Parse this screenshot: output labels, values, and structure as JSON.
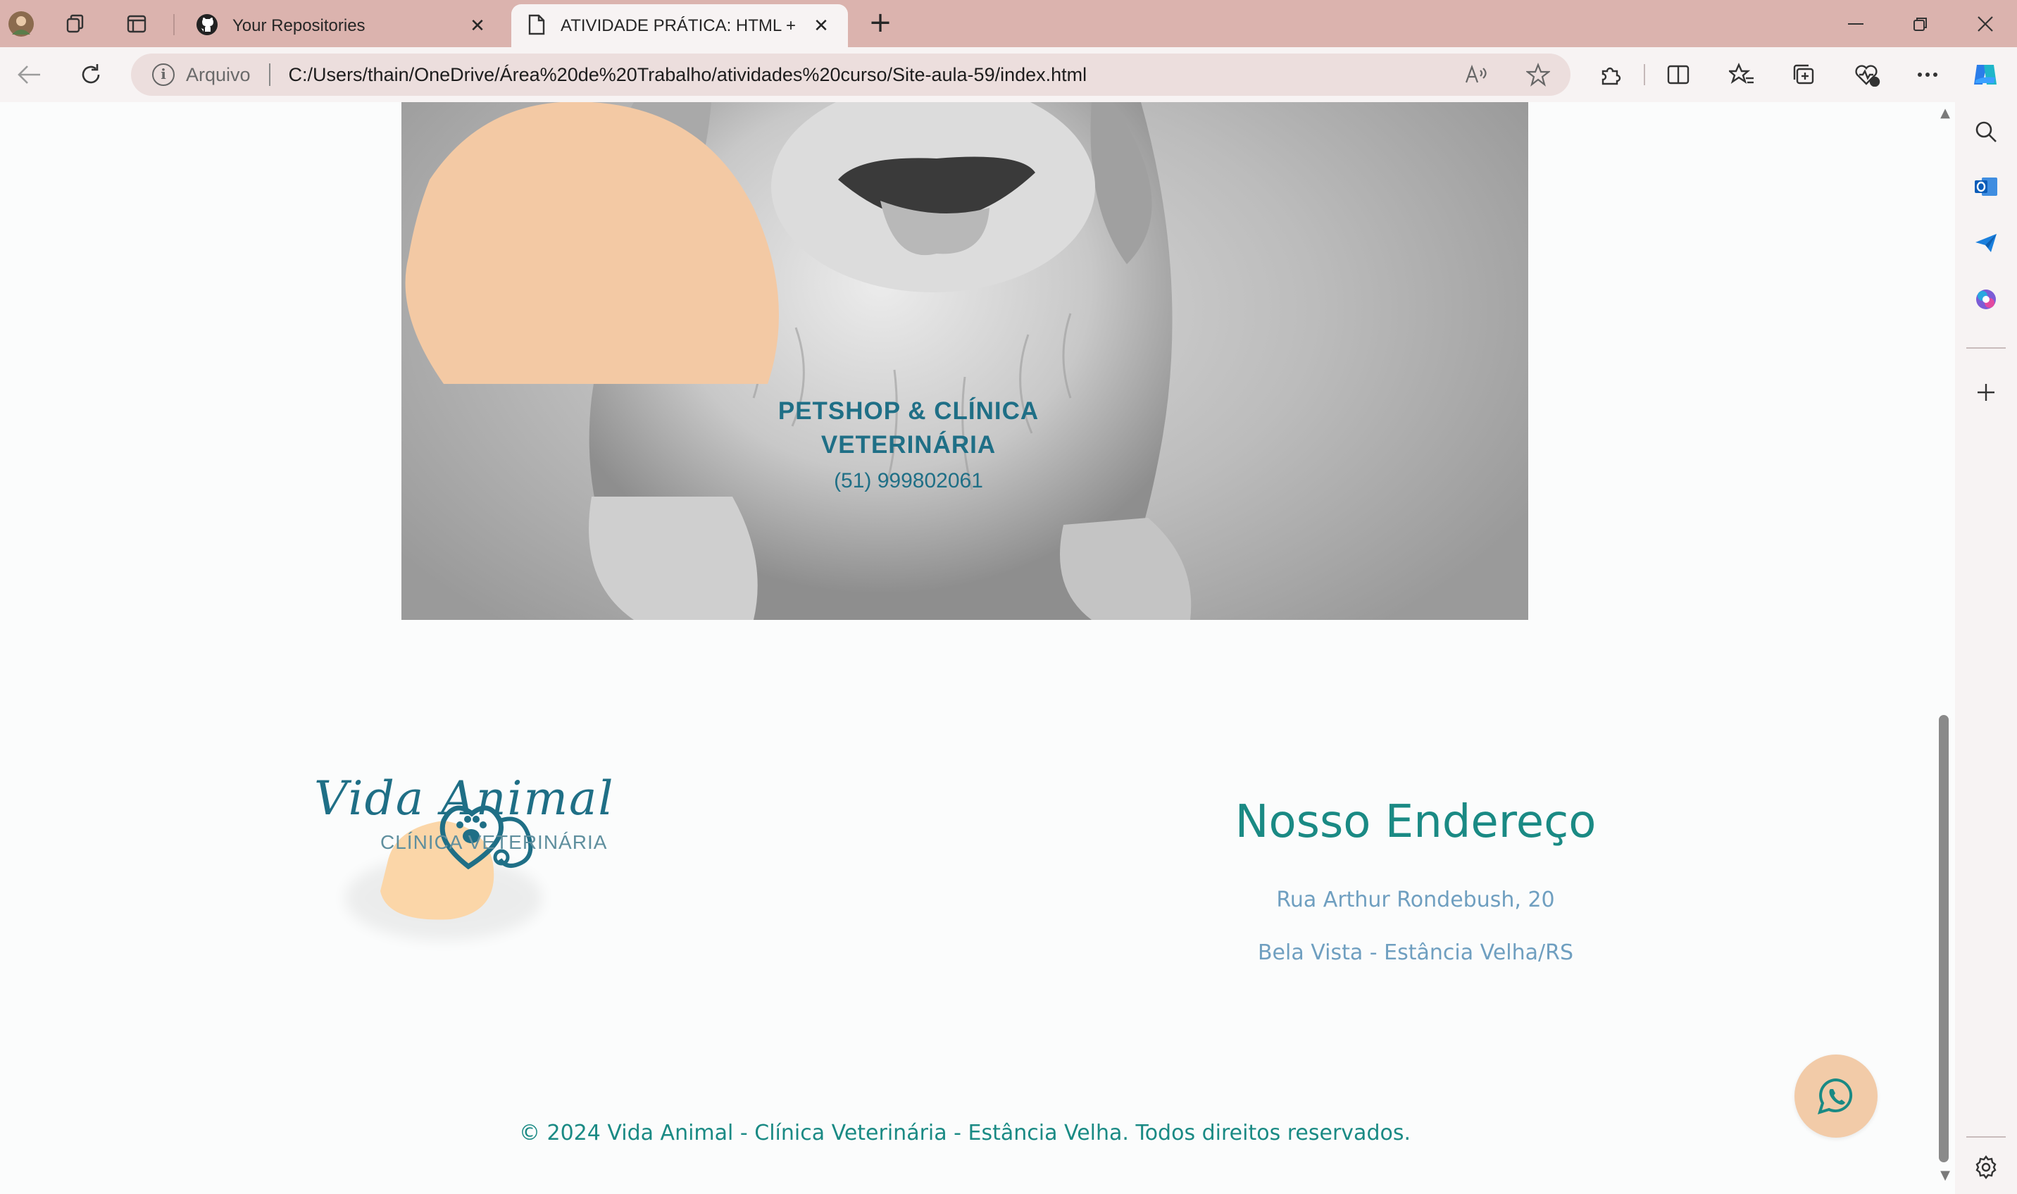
{
  "tabs": [
    {
      "title": "Your Repositories",
      "close": "✕"
    },
    {
      "title": "ATIVIDADE PRÁTICA: HTML + CSS",
      "close": "✕"
    }
  ],
  "new_tab": "+",
  "window_controls": {
    "minimize": "—",
    "restore": "❐",
    "close": "✕"
  },
  "address_bar": {
    "scheme_label": "Arquivo",
    "info_glyph": "i",
    "url": "C:/Users/thain/OneDrive/Área%20de%20Trabalho/atividades%20curso/Site-aula-59/index.html"
  },
  "hero": {
    "badge_line1": "PETSHOP & CLÍNICA",
    "badge_line2": "VETERINÁRIA",
    "badge_phone": "(51) 999802061"
  },
  "logo": {
    "script_name": "Vida Animal",
    "subtitle": "CLÍNICA VETERINÁRIA"
  },
  "address_section": {
    "title": "Nosso Endereço",
    "street": "Rua Arthur Rondebush, 20",
    "city": "Bela Vista - Estância Velha/RS"
  },
  "footer": {
    "copyright": "© 2024 Vida Animal - Clínica Veterinária - Estância Velha. Todos direitos reservados."
  },
  "colors": {
    "teal": "#1a8a84",
    "badge_peach": "#f3c9a4",
    "tab_strip": "#dbb3ae"
  },
  "icons": [
    "profile-icon",
    "workspaces-icon",
    "tab-actions-icon",
    "github-icon",
    "page-icon",
    "back-icon",
    "refresh-icon",
    "read-aloud-icon",
    "favorite-star-icon",
    "extensions-icon",
    "split-screen-icon",
    "favorites-icon",
    "collections-icon",
    "browser-essentials-icon",
    "more-icon",
    "copilot-icon",
    "search-icon",
    "outlook-icon",
    "send-icon",
    "office-icon",
    "add-icon",
    "settings-icon",
    "whatsapp-icon"
  ]
}
